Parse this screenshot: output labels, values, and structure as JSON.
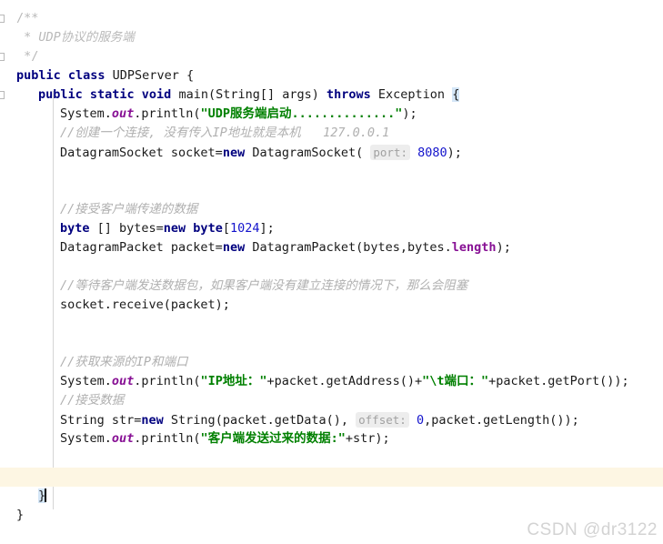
{
  "editor": {
    "language": "java",
    "watermark": "CSDN @dr3122",
    "colors": {
      "background": "#ffffff",
      "keyword": "#00007f",
      "string": "#008000",
      "number": "#1414cc",
      "comment": "#b0b0b0",
      "static_field": "#871094",
      "current_line_highlight": "#fdf6e3",
      "brace_match_highlight": "#d4e6f7",
      "indent_guide": "#d6d6d6",
      "watermark": "#d3d3d3"
    },
    "fold_markers": [
      {
        "line": 0
      },
      {
        "line": 2
      },
      {
        "line": 4
      },
      {
        "line": 24
      }
    ],
    "current_line_index": 24,
    "cursor_line_index": 24,
    "inlay_hints": [
      {
        "label": "port:",
        "value": "8080",
        "line": 6
      },
      {
        "label": "offset:",
        "value": "0",
        "line": 21
      }
    ]
  },
  "code_lines": [
    {
      "indent": 0,
      "tokens": [
        {
          "t": "jdoc-d",
          "v": "/**"
        }
      ]
    },
    {
      "indent": 0,
      "tokens": [
        {
          "t": "jdoc-d",
          "v": " * "
        },
        {
          "t": "jdoc",
          "v": "UDP协议的服务端"
        }
      ]
    },
    {
      "indent": 0,
      "tokens": [
        {
          "t": "jdoc-d",
          "v": " */"
        }
      ]
    },
    {
      "indent": 0,
      "tokens": [
        {
          "t": "kw",
          "v": "public class "
        },
        {
          "t": "plain",
          "v": "UDPServer {"
        }
      ]
    },
    {
      "indent": 1,
      "tokens": [
        {
          "t": "kw",
          "v": "public static void "
        },
        {
          "t": "plain",
          "v": "main(String[] args) "
        },
        {
          "t": "kw",
          "v": "throws "
        },
        {
          "t": "plain",
          "v": "Exception "
        },
        {
          "t": "brace-hl",
          "v": "{"
        }
      ]
    },
    {
      "indent": 2,
      "tokens": [
        {
          "t": "plain",
          "v": "System."
        },
        {
          "t": "field",
          "v": "out"
        },
        {
          "t": "plain",
          "v": ".println("
        },
        {
          "t": "str",
          "v": "\"UDP服务端启动..............\""
        },
        {
          "t": "plain",
          "v": ");"
        }
      ]
    },
    {
      "indent": 2,
      "tokens": [
        {
          "t": "cmt",
          "v": "//创建一个连接, 没有传入IP地址就是本机   127.0.0.1"
        }
      ]
    },
    {
      "indent": 2,
      "tokens": [
        {
          "t": "plain",
          "v": "DatagramSocket socket="
        },
        {
          "t": "kw",
          "v": "new "
        },
        {
          "t": "plain",
          "v": "DatagramSocket( "
        },
        {
          "t": "hint",
          "v": "port:"
        },
        {
          "t": "plain",
          "v": " "
        },
        {
          "t": "num",
          "v": "8080"
        },
        {
          "t": "plain",
          "v": ");"
        }
      ]
    },
    {
      "indent": 0,
      "tokens": []
    },
    {
      "indent": 0,
      "tokens": []
    },
    {
      "indent": 2,
      "tokens": [
        {
          "t": "cmt",
          "v": "//接受客户端传递的数据"
        }
      ]
    },
    {
      "indent": 2,
      "tokens": [
        {
          "t": "kw",
          "v": "byte "
        },
        {
          "t": "plain",
          "v": "[] bytes="
        },
        {
          "t": "kw",
          "v": "new byte"
        },
        {
          "t": "plain",
          "v": "["
        },
        {
          "t": "num",
          "v": "1024"
        },
        {
          "t": "plain",
          "v": "];"
        }
      ]
    },
    {
      "indent": 2,
      "tokens": [
        {
          "t": "plain",
          "v": "DatagramPacket packet="
        },
        {
          "t": "kw",
          "v": "new "
        },
        {
          "t": "plain",
          "v": "DatagramPacket(bytes,bytes."
        },
        {
          "t": "fieldn",
          "v": "length"
        },
        {
          "t": "plain",
          "v": ");"
        }
      ]
    },
    {
      "indent": 0,
      "tokens": []
    },
    {
      "indent": 2,
      "tokens": [
        {
          "t": "cmt",
          "v": "//等待客户端发送数据包，如果客户端没有建立连接的情况下，那么会阻塞"
        }
      ]
    },
    {
      "indent": 2,
      "tokens": [
        {
          "t": "plain",
          "v": "socket.receive(packet);"
        }
      ]
    },
    {
      "indent": 0,
      "tokens": []
    },
    {
      "indent": 0,
      "tokens": []
    },
    {
      "indent": 2,
      "tokens": [
        {
          "t": "cmt",
          "v": "//获取来源的IP和端口"
        }
      ]
    },
    {
      "indent": 2,
      "tokens": [
        {
          "t": "plain",
          "v": "System."
        },
        {
          "t": "field",
          "v": "out"
        },
        {
          "t": "plain",
          "v": ".println("
        },
        {
          "t": "str",
          "v": "\"IP地址：\""
        },
        {
          "t": "plain",
          "v": "+packet.getAddress()+"
        },
        {
          "t": "str",
          "v": "\"\\t端口：\""
        },
        {
          "t": "plain",
          "v": "+packet.getPort());"
        }
      ]
    },
    {
      "indent": 2,
      "tokens": [
        {
          "t": "cmt",
          "v": "//接受数据"
        }
      ]
    },
    {
      "indent": 2,
      "tokens": [
        {
          "t": "plain",
          "v": "String str="
        },
        {
          "t": "kw",
          "v": "new "
        },
        {
          "t": "plain",
          "v": "String(packet.getData(), "
        },
        {
          "t": "hint",
          "v": "offset:"
        },
        {
          "t": "plain",
          "v": " "
        },
        {
          "t": "num",
          "v": "0"
        },
        {
          "t": "plain",
          "v": ",packet.getLength());"
        }
      ]
    },
    {
      "indent": 2,
      "tokens": [
        {
          "t": "plain",
          "v": "System."
        },
        {
          "t": "field",
          "v": "out"
        },
        {
          "t": "plain",
          "v": ".println("
        },
        {
          "t": "str",
          "v": "\"客户端发送过来的数据:\""
        },
        {
          "t": "plain",
          "v": "+str);"
        }
      ]
    },
    {
      "indent": 0,
      "tokens": []
    },
    {
      "indent": 0,
      "tokens": []
    },
    {
      "indent": 1,
      "tokens": [
        {
          "t": "brace-hl",
          "v": "}"
        },
        {
          "t": "cursor",
          "v": ""
        }
      ]
    },
    {
      "indent": 0,
      "tokens": [
        {
          "t": "plain",
          "v": "}"
        }
      ]
    }
  ]
}
